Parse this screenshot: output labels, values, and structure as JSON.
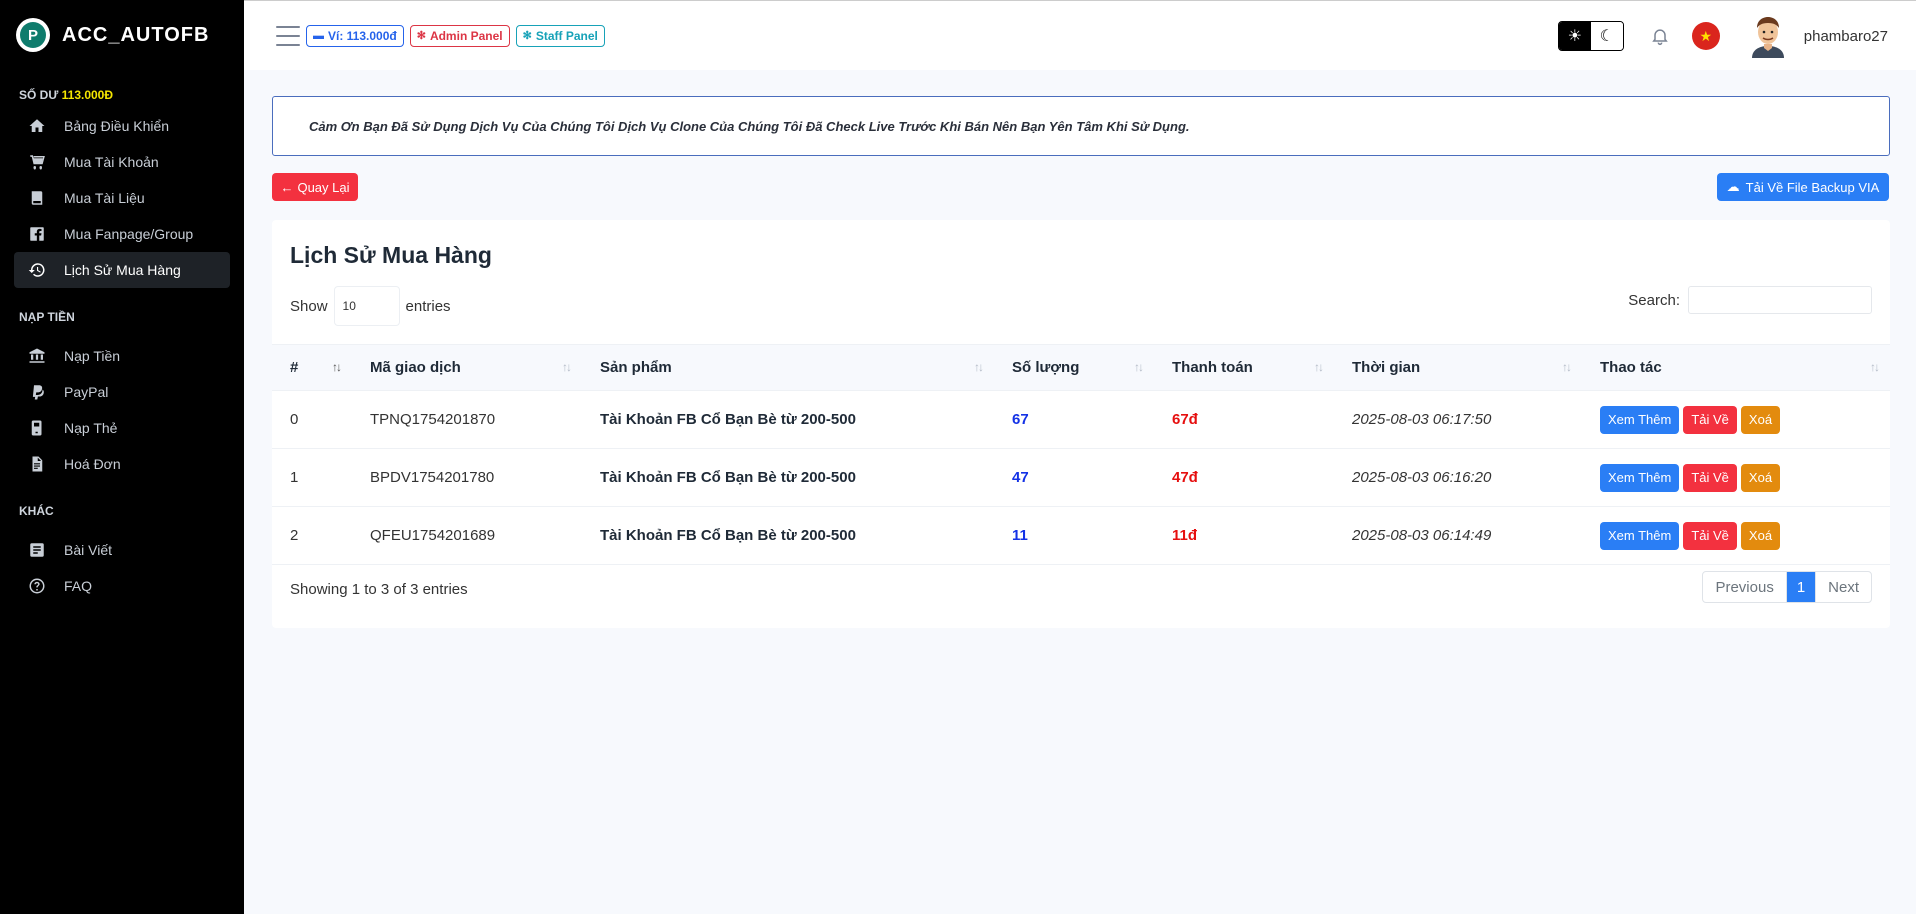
{
  "brand": {
    "name": "ACC_AUTOFB",
    "logo_letter": "P"
  },
  "sidebar": {
    "balance_label": "SỐ DƯ",
    "balance_amount": "113.000Đ",
    "main_items": [
      {
        "label": "Bảng Điều Khiển",
        "icon": "home-icon"
      },
      {
        "label": "Mua Tài Khoản",
        "icon": "cart-icon"
      },
      {
        "label": "Mua Tài Liệu",
        "icon": "book-icon"
      },
      {
        "label": "Mua Fanpage/Group",
        "icon": "facebook-icon"
      },
      {
        "label": "Lịch Sử Mua Hàng",
        "icon": "history-icon",
        "active": true
      }
    ],
    "section_topup": "NẠP TIỀN",
    "topup_items": [
      {
        "label": "Nạp Tiền",
        "icon": "bank-icon"
      },
      {
        "label": "PayPal",
        "icon": "paypal-icon"
      },
      {
        "label": "Nạp Thẻ",
        "icon": "card-icon"
      },
      {
        "label": "Hoá Đơn",
        "icon": "invoice-icon"
      }
    ],
    "section_other": "KHÁC",
    "other_items": [
      {
        "label": "Bài Viết",
        "icon": "article-icon"
      },
      {
        "label": "FAQ",
        "icon": "question-icon"
      }
    ]
  },
  "topbar": {
    "wallet_label": "Ví: 113.000đ",
    "admin_label": "Admin Panel",
    "staff_label": "Staff Panel",
    "username": "phambaro27"
  },
  "notice": "Cảm Ơn Bạn Đã Sử Dụng Dịch Vụ Của Chúng Tôi Dịch Vụ Clone Của Chúng Tôi Đã Check Live Trước Khi Bán Nên Bạn Yên Tâm Khi Sử Dụng.",
  "actions": {
    "back_label": "Quay Lại",
    "download_backup_label": "Tải Về File Backup VIA"
  },
  "card": {
    "title": "Lịch Sử Mua Hàng",
    "show_label": "Show",
    "entries_value": "10",
    "entries_label": "entries",
    "search_label": "Search:",
    "search_value": ""
  },
  "table": {
    "headers": [
      "#",
      "Mã giao dịch",
      "Sản phẩm",
      "Số lượng",
      "Thanh toán",
      "Thời gian",
      "Thao tác"
    ],
    "rows": [
      {
        "idx": "0",
        "code": "TPNQ1754201870",
        "product": "Tài Khoản FB Cổ Bạn Bè từ 200-500",
        "qty": "67",
        "pay": "67đ",
        "time": "2025-08-03 06:17:50"
      },
      {
        "idx": "1",
        "code": "BPDV1754201780",
        "product": "Tài Khoản FB Cổ Bạn Bè từ 200-500",
        "qty": "47",
        "pay": "47đ",
        "time": "2025-08-03 06:16:20"
      },
      {
        "idx": "2",
        "code": "QFEU1754201689",
        "product": "Tài Khoản FB Cổ Bạn Bè từ 200-500",
        "qty": "11",
        "pay": "11đ",
        "time": "2025-08-03 06:14:49"
      }
    ],
    "row_actions": {
      "view": "Xem Thêm",
      "download": "Tải Về",
      "delete": "Xoá"
    }
  },
  "footer": {
    "info": "Showing 1 to 3 of 3 entries",
    "previous": "Previous",
    "current_page": "1",
    "next": "Next"
  }
}
